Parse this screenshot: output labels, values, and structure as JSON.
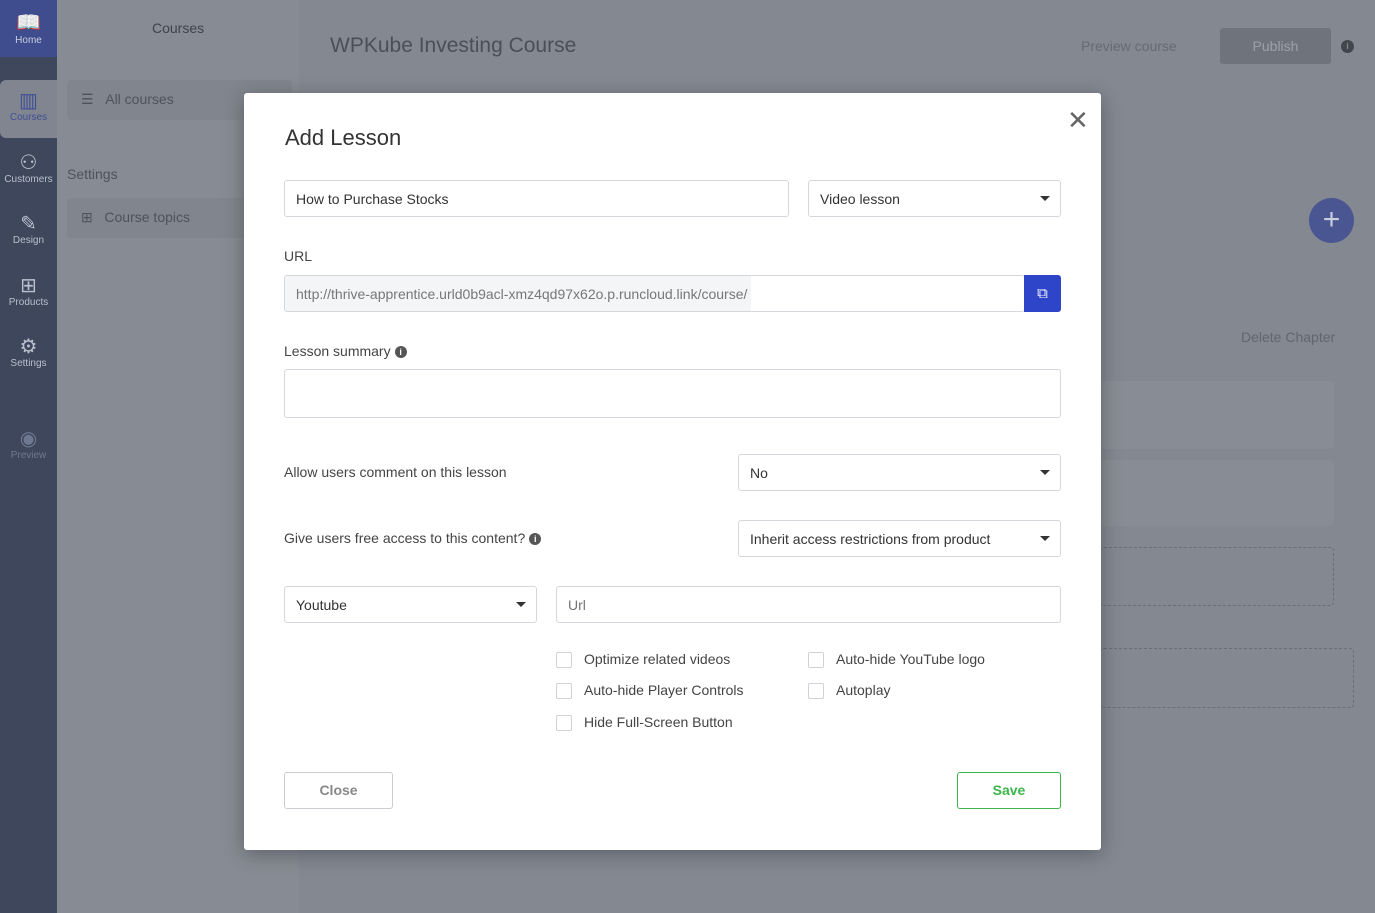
{
  "sidebar": {
    "items": [
      {
        "label": "Home",
        "icon": "book-icon"
      },
      {
        "label": "Courses",
        "icon": "library-icon"
      },
      {
        "label": "Customers",
        "icon": "users-icon"
      },
      {
        "label": "Design",
        "icon": "brush-icon"
      },
      {
        "label": "Products",
        "icon": "boxes-icon"
      },
      {
        "label": "Settings",
        "icon": "gear-icon"
      },
      {
        "label": "Preview",
        "icon": "eye-icon"
      }
    ]
  },
  "leftnav": {
    "title": "Courses",
    "all_courses": "All courses",
    "settings_section": "Settings",
    "course_topics": "Course topics"
  },
  "header": {
    "course_title": "WPKube Investing Course",
    "preview": "Preview course",
    "publish": "Publish"
  },
  "main": {
    "delete_chapter": "Delete Chapter"
  },
  "modal": {
    "title": "Add Lesson",
    "lesson_name": "How to Purchase Stocks",
    "lesson_type": "Video lesson",
    "url_label": "URL",
    "url_value": "http://thrive-apprentice.urld0b9acl-xmz4qd97x62o.p.runcloud.link/course/",
    "summary_label": "Lesson summary",
    "summary_value": "",
    "comments_label": "Allow users comment on this lesson",
    "comments_value": "No",
    "access_label": "Give users free access to this content?",
    "access_value": "Inherit access restrictions from product",
    "video_source": "Youtube",
    "video_url_placeholder": "Url",
    "options": [
      {
        "label": "Optimize related videos",
        "checked": false
      },
      {
        "label": "Auto-hide YouTube logo",
        "checked": false
      },
      {
        "label": "Auto-hide Player Controls",
        "checked": false
      },
      {
        "label": "Autoplay",
        "checked": false
      },
      {
        "label": "Hide Full-Screen Button",
        "checked": false
      }
    ],
    "close": "Close",
    "save": "Save"
  },
  "colors": {
    "accent": "#2f45c9",
    "save": "#3cb54a"
  }
}
